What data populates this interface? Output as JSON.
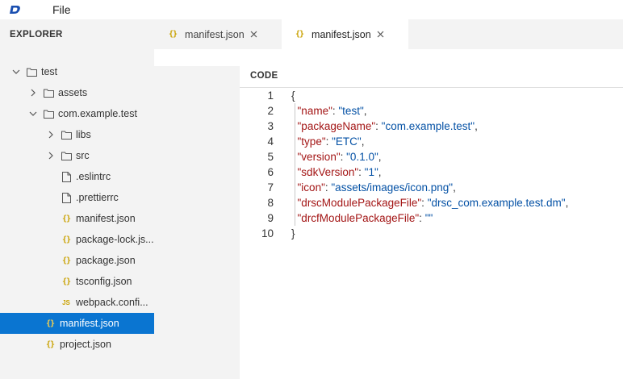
{
  "menubar": {
    "file_label": "File"
  },
  "sidebar": {
    "title": "EXPLORER",
    "items": [
      {
        "label": "test",
        "icon": "folder-icon",
        "expanded": true
      },
      {
        "label": "assets",
        "icon": "folder-icon",
        "expanded": false
      },
      {
        "label": "com.example.test",
        "icon": "folder-icon",
        "expanded": true
      },
      {
        "label": "libs",
        "icon": "folder-icon",
        "expanded": false
      },
      {
        "label": "src",
        "icon": "folder-icon",
        "expanded": false
      },
      {
        "label": ".eslintrc",
        "icon": "file-icon"
      },
      {
        "label": ".prettierrc",
        "icon": "file-icon"
      },
      {
        "label": "manifest.json",
        "icon": "json-file-icon"
      },
      {
        "label": "package-lock.js...",
        "icon": "json-file-icon"
      },
      {
        "label": "package.json",
        "icon": "json-file-icon"
      },
      {
        "label": "tsconfig.json",
        "icon": "json-file-icon"
      },
      {
        "label": "webpack.confi...",
        "icon": "js-file-icon"
      },
      {
        "label": "manifest.json",
        "icon": "json-file-icon",
        "selected": true
      },
      {
        "label": "project.json",
        "icon": "json-file-icon"
      }
    ]
  },
  "tabs": [
    {
      "label": "manifest.json",
      "active": false
    },
    {
      "label": "manifest.json",
      "active": true
    }
  ],
  "editor": {
    "section_label": "CODE",
    "line_numbers": [
      "1",
      "2",
      "3",
      "4",
      "5",
      "6",
      "7",
      "8",
      "9",
      "10"
    ],
    "lines": [
      {
        "parts": [
          {
            "t": "p",
            "s": "{"
          }
        ]
      },
      {
        "parts": [
          {
            "t": "p",
            "s": "  "
          },
          {
            "t": "k",
            "s": "\"name\""
          },
          {
            "t": "p",
            "s": ": "
          },
          {
            "t": "v",
            "s": "\"test\""
          },
          {
            "t": "p",
            "s": ","
          }
        ]
      },
      {
        "parts": [
          {
            "t": "p",
            "s": "  "
          },
          {
            "t": "k",
            "s": "\"packageName\""
          },
          {
            "t": "p",
            "s": ": "
          },
          {
            "t": "v",
            "s": "\"com.example.test\""
          },
          {
            "t": "p",
            "s": ","
          }
        ]
      },
      {
        "parts": [
          {
            "t": "p",
            "s": "  "
          },
          {
            "t": "k",
            "s": "\"type\""
          },
          {
            "t": "p",
            "s": ": "
          },
          {
            "t": "v",
            "s": "\"ETC\""
          },
          {
            "t": "p",
            "s": ","
          }
        ]
      },
      {
        "parts": [
          {
            "t": "p",
            "s": "  "
          },
          {
            "t": "k",
            "s": "\"version\""
          },
          {
            "t": "p",
            "s": ": "
          },
          {
            "t": "v",
            "s": "\"0.1.0\""
          },
          {
            "t": "p",
            "s": ","
          }
        ]
      },
      {
        "parts": [
          {
            "t": "p",
            "s": "  "
          },
          {
            "t": "k",
            "s": "\"sdkVersion\""
          },
          {
            "t": "p",
            "s": ": "
          },
          {
            "t": "v",
            "s": "\"1\""
          },
          {
            "t": "p",
            "s": ","
          }
        ]
      },
      {
        "parts": [
          {
            "t": "p",
            "s": "  "
          },
          {
            "t": "k",
            "s": "\"icon\""
          },
          {
            "t": "p",
            "s": ": "
          },
          {
            "t": "v",
            "s": "\"assets/images/icon.png\""
          },
          {
            "t": "p",
            "s": ","
          }
        ]
      },
      {
        "parts": [
          {
            "t": "p",
            "s": "  "
          },
          {
            "t": "k",
            "s": "\"drscModulePackageFile\""
          },
          {
            "t": "p",
            "s": ": "
          },
          {
            "t": "v",
            "s": "\"drsc_com.example.test.dm\""
          },
          {
            "t": "p",
            "s": ","
          }
        ]
      },
      {
        "parts": [
          {
            "t": "p",
            "s": "  "
          },
          {
            "t": "k",
            "s": "\"drcfModulePackageFile\""
          },
          {
            "t": "p",
            "s": ": "
          },
          {
            "t": "v",
            "s": "\"\""
          }
        ]
      },
      {
        "parts": [
          {
            "t": "p",
            "s": "}"
          }
        ]
      }
    ]
  },
  "colors": {
    "accent": "#0a75d1",
    "json_key": "#a31515",
    "json_string": "#0451a5",
    "json_icon": "#c9a100"
  }
}
